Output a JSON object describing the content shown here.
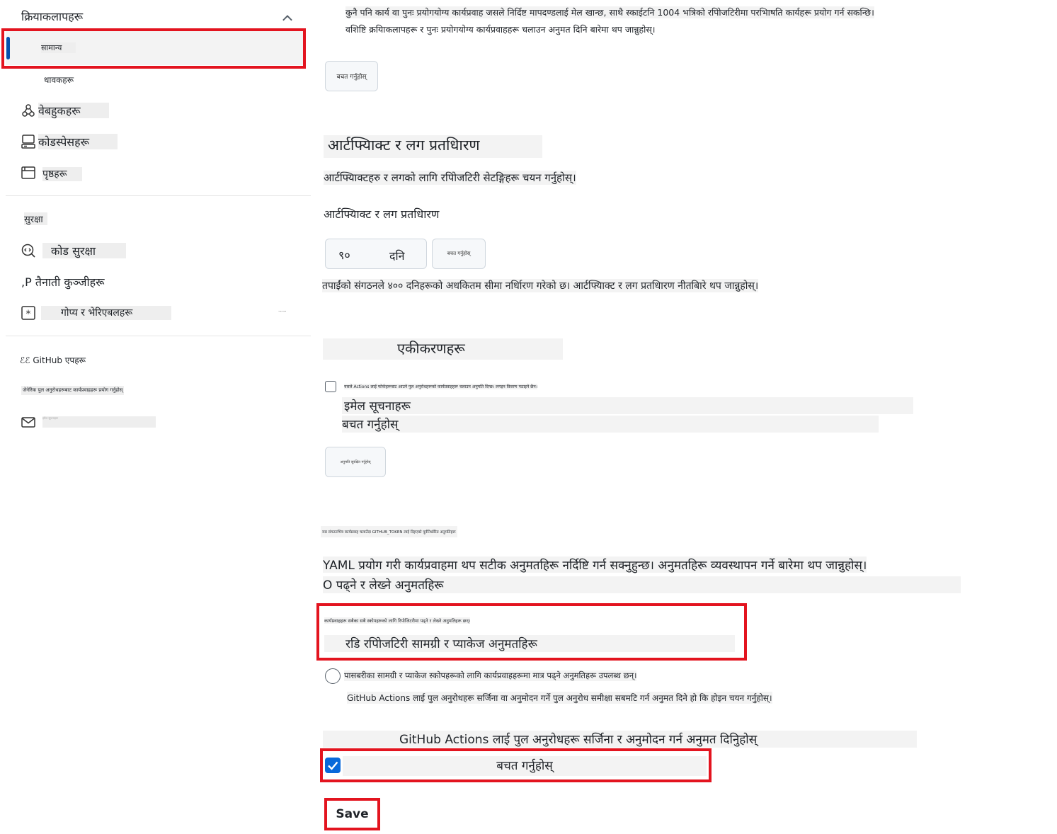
{
  "sidebar": {
    "actions_label": "क्रियाकलापहरू",
    "general_label": "सामान्य",
    "runners_label": "धावकहरू",
    "webhooks_label": "वेबहुकहरू",
    "codespaces_label": "कोडस्पेसहरू",
    "pages_label": "पृष्ठहरू",
    "security_heading": "सुरक्षा",
    "code_security_label": "कोड सुरक्षा",
    "deploy_keys_label": "तैनाती कुञ्जीहरू",
    "deploy_keys_prefix": ",P",
    "secrets_label": "गोप्य र भेरिएबलहरू",
    "secrets_trailing": "·-·-·",
    "github_apps_label": "GitHub एपहरू",
    "github_apps_prefix": "ℰℰ",
    "integrations_sub_label": "जेनेरिक पुल अनुरोधहरूबाट कार्यप्रवाहहरू प्रयोग गर्नुहोस्",
    "email_label": "इमेल सूचनाहरू"
  },
  "main": {
    "intro_line1": "कुनै पनि कार्य वा पुनः प्रयोगयोग्य कार्यप्रवाह जसले निर्दिष्ट मापदण्डलाई मेल खान्छ, साथै स्काईटनि 1004 भत्रिको रपिोजटिरीमा परभिाषति कार्यहरू प्रयोग गर्न सकन्छि।",
    "intro_line2": "वशिष्टि क्रयिाकलापहरू र पुनः प्रयोगयोग्य कार्यप्रवाहहरू चलाउन अनुमत दिनि बारेमा थप जान्नुहोस्।",
    "save_button_1": "बचत गर्नुहोस्",
    "artifact_heading": "आर्टफ्यािक्ट र लग प्रतधिारण",
    "artifact_desc": "आर्टफ्यािक्टहरु र लगको लागि रपिोजटिरी सेटङ्गिहरू चयन गर्नुहोस्।",
    "artifact_sublabel": "आर्टफ्यािक्ट र लग प्रतधिारण",
    "retention_value": "९०",
    "retention_unit": "दनि",
    "save_button_2": "बचत गर्नुहोस्",
    "retention_note": "तपाईंको संगठनले ४०० दनिहरूको अधकितम सीमा नर्धिारण गरेको छ। आर्टफ्यािक्ट र लग प्रतधिारण नीतबिारे थप जान्नुहोस्।",
    "integrations_heading": "एकीकरणहरू",
    "checkbox_note": "यसले Actions लाई फोर्कहरूबाट आउने पुल अनुरोधहरूको कार्यप्रवाहहरू चलाउन अनुमति दिन्छ। लगइन विवरण पठाइने छैन।",
    "email_notifications": "इमेल सूचनाहरू",
    "save_label": "बचत गर्नुहोस्",
    "save_button_3": "अनुमति सुरक्षित गर्नुहोस्",
    "token_note": "यस संगठनभित्र कार्यप्रवाह चलाउँदा GITHUB_TOKEN लाई दिइएको पूर्वनिर्धारित अनुमतिहरू",
    "yaml_line": "YAML प्रयोग गरी कार्यप्रवाहमा थप सटीक अनुमतहिरू नर्दिष्टि गर्न सक्नुहुन्छ। अनुमतहिरू व्यवस्थापन गर्ने बारेमा थप जान्नुहोस्।",
    "read_write_label": "O पढ्ने र लेख्ने अनुमतहिरू",
    "rw_desc": "कार्यप्रवाहहरू सबैका सबै स्कोपहरूको लागि रिपोजिटरीमा पढ्ने र लेख्ने अनुमतिहरू छन्।",
    "read_repo_label": "रडि रपिोजटिरी सामग्री र प्याकेज अनुमतहिरू",
    "read_only_desc": "पासबरीका सामग्री र प्याकेज स्कोपहरूको लागि कार्यप्रवाहहरूमा मात्र पढ्ने अनुमतिहरू उपलब्ध छन्।",
    "pr_desc": "GitHub Actions लाई पुल अनुरोधहरू सर्जिना वा अनुमोदन गर्ने पुल अनुरोध समीक्षा सबमटि गर्न अनुमत दिने हो कि होइन चयन गर्नुहोस्।",
    "allow_pr_label": "GitHub Actions लाई पुल अनुरोधहरू सर्जिना र अनुमोदन गर्न अनुमत दिनुिहोस्",
    "save_checkbox_label": "बचत गर्नुहोस्",
    "final_save": "Save"
  },
  "colors": {
    "highlight_red": "#e3141f",
    "accent_blue": "#0969da",
    "active_bar": "#0550ae"
  }
}
